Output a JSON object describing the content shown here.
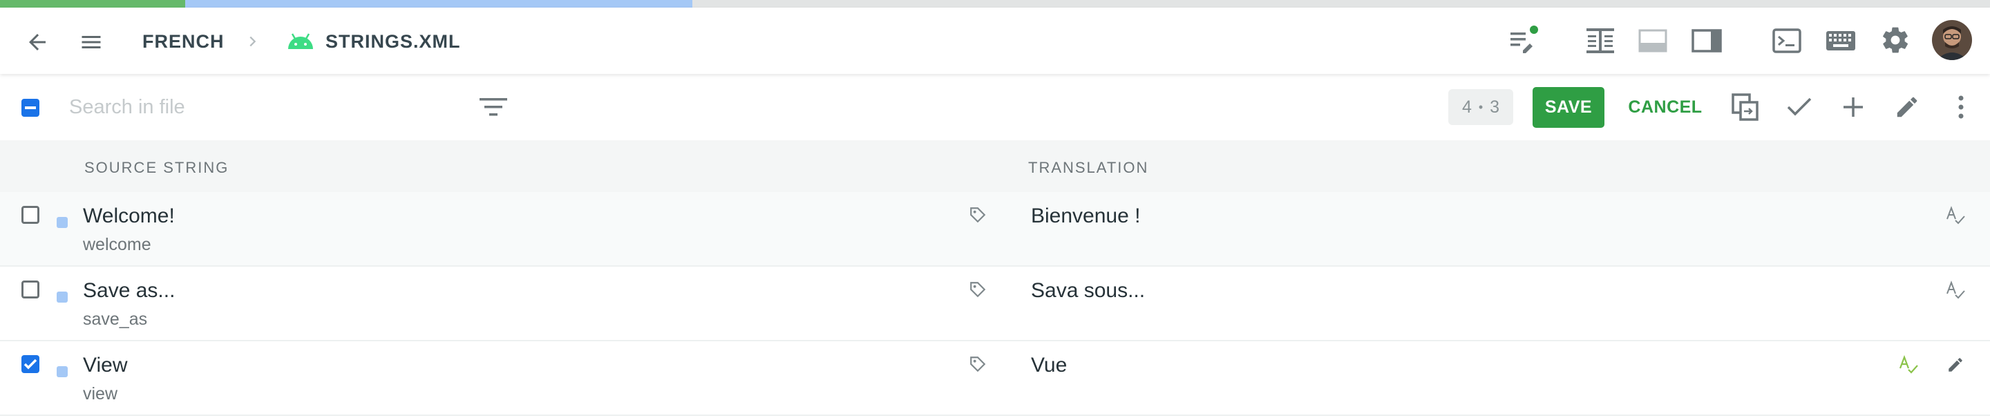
{
  "progress": {
    "translated_fraction": 0.093,
    "approved_fraction": 0.255
  },
  "header": {
    "crumb_language": "FRENCH",
    "crumb_file": "STRINGS.XML",
    "icons": {
      "back": "arrow-left-icon",
      "menu": "hamburger-menu-icon",
      "chevron": "chevron-right-icon",
      "platform": "android-icon",
      "notes": "notes-pencil-icon",
      "split": "split-columns-icon",
      "bottom_panel": "bottom-panel-icon",
      "side_panel": "side-panel-icon",
      "terminal": "terminal-icon",
      "keyboard": "keyboard-icon",
      "settings": "gear-icon",
      "avatar": "user-avatar"
    },
    "status_dot_color": "#2f9e44"
  },
  "toolbar": {
    "search_placeholder": "Search in file",
    "counter_left": "4",
    "counter_sep": "•",
    "counter_right": "3",
    "save_label": "SAVE",
    "cancel_label": "CANCEL"
  },
  "table": {
    "col_source": "SOURCE STRING",
    "col_translation": "TRANSLATION",
    "rows": [
      {
        "source": "Welcome!",
        "key": "welcome",
        "translation": "Bienvenue !",
        "checked": false,
        "spell_status": "neutral"
      },
      {
        "source": "Save as...",
        "key": "save_as",
        "translation": "Sava sous...",
        "checked": false,
        "spell_status": "neutral"
      },
      {
        "source": "View",
        "key": "view",
        "translation": "Vue",
        "checked": true,
        "spell_status": "ok"
      }
    ]
  },
  "colors": {
    "accent_green": "#2f9e44",
    "accent_blue": "#1a73e8",
    "translated": "#65b96a",
    "approved": "#a4c8f6"
  }
}
